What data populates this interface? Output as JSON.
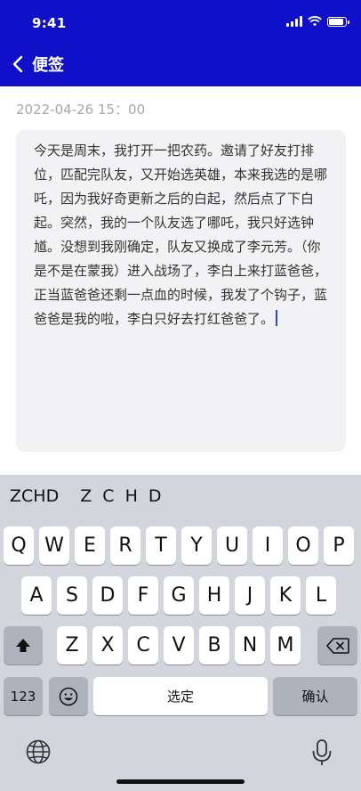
{
  "status_bar": {
    "time": "9:41"
  },
  "nav": {
    "back_icon": "chevron-left-icon",
    "title": "便签"
  },
  "note": {
    "timestamp": "2022-04-26 15：00",
    "content": "今天是周末，我打开一把农药。邀请了好友打排位，匹配完队友，又开始选英雄，本来我选的是哪吒，因为我好奇更新之后的白起，然后点了下白起。突然，我的一个队友选了哪吒，我只好选钟馗。没想到我刚确定，队友又换成了李元芳。（你是不是在蒙我）进入战场了，李白上来打蓝爸爸，正当蓝爸爸还剩一点血的时候，我发了个钩子，蓝爸爸是我的啦，李白只好去打红爸爸了。"
  },
  "keyboard": {
    "suggestions": [
      "ZCHD",
      "Z C H D"
    ],
    "row1": [
      "Q",
      "W",
      "E",
      "R",
      "T",
      "Y",
      "U",
      "I",
      "O",
      "P"
    ],
    "row2": [
      "A",
      "S",
      "D",
      "F",
      "G",
      "H",
      "J",
      "K",
      "L"
    ],
    "row3": [
      "Z",
      "X",
      "C",
      "V",
      "B",
      "N",
      "M"
    ],
    "numbers_key": "123",
    "space_key": "选定",
    "return_key": "确认",
    "icons": {
      "shift": "shift-icon",
      "delete": "delete-icon",
      "emoji": "emoji-icon",
      "globe": "globe-icon",
      "mic": "mic-icon"
    }
  },
  "colors": {
    "header": "#1010c8",
    "caret": "#2b47d6",
    "keyboard_bg": "#d2d5dc",
    "key_bg": "#ffffff",
    "dark_key_bg": "#adb2bc"
  }
}
